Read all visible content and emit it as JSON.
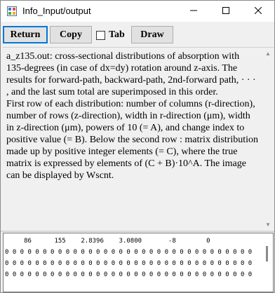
{
  "window": {
    "title": "Info_Input/output"
  },
  "toolbar": {
    "return_label": "Return",
    "copy_label": "Copy",
    "tab_label": "Tab",
    "tab_checked": false,
    "draw_label": "Draw"
  },
  "info_text": {
    "paragraph1": "a_z135.out: cross-sectional distributions of absorption with 135-degrees (in case of dx=dy) rotation around z-axis. The results for forward-path, backward-path, 2nd-forward path, · · · , and the last sum total are superimposed in this order.",
    "paragraph2": " First row of each distribution: number of columns (r-direction), number of rows (z-direction), width in r-direction (μm), width in z-direction (μm), powers of 10 (= A), and change index to positive value (= B). Below the second row : matrix distribution made up by positive integer elements (= C), where the true matrix is expressed by elements of (C + B)·10^A. The image can be displayed by Wscnt."
  },
  "data_output": {
    "header_row": "     86      155    2.8396    3.0800       -8        0",
    "rows": [
      "0 0 0 0 0 0 0 0 0 0 0 0 0 0 0 0 0 0 0 0 0 0 0 0 0 0 0 0 0 0 0 0 0",
      "0 0 0 0 0 0 0 0 0 0 0 0 0 0 0 0 0 0 0 0 0 0 0 0 0 0 0 0 0 0 0 0 0",
      "0 0 0 0 0 0 0 0 0 0 0 0 0 0 0 0 0 0 0 0 0 0 0 0 0 0 0 0 0 0 0 0 0"
    ]
  },
  "icons": {
    "app": "app-icon",
    "minimize": "minimize-icon",
    "maximize": "maximize-icon",
    "close": "close-icon",
    "scroll_up": "scroll-up-icon",
    "scroll_down": "scroll-down-icon"
  },
  "colors": {
    "focus_border": "#0078d7",
    "button_bg": "#e1e1e1",
    "window_bg": "#f0f0f0"
  }
}
